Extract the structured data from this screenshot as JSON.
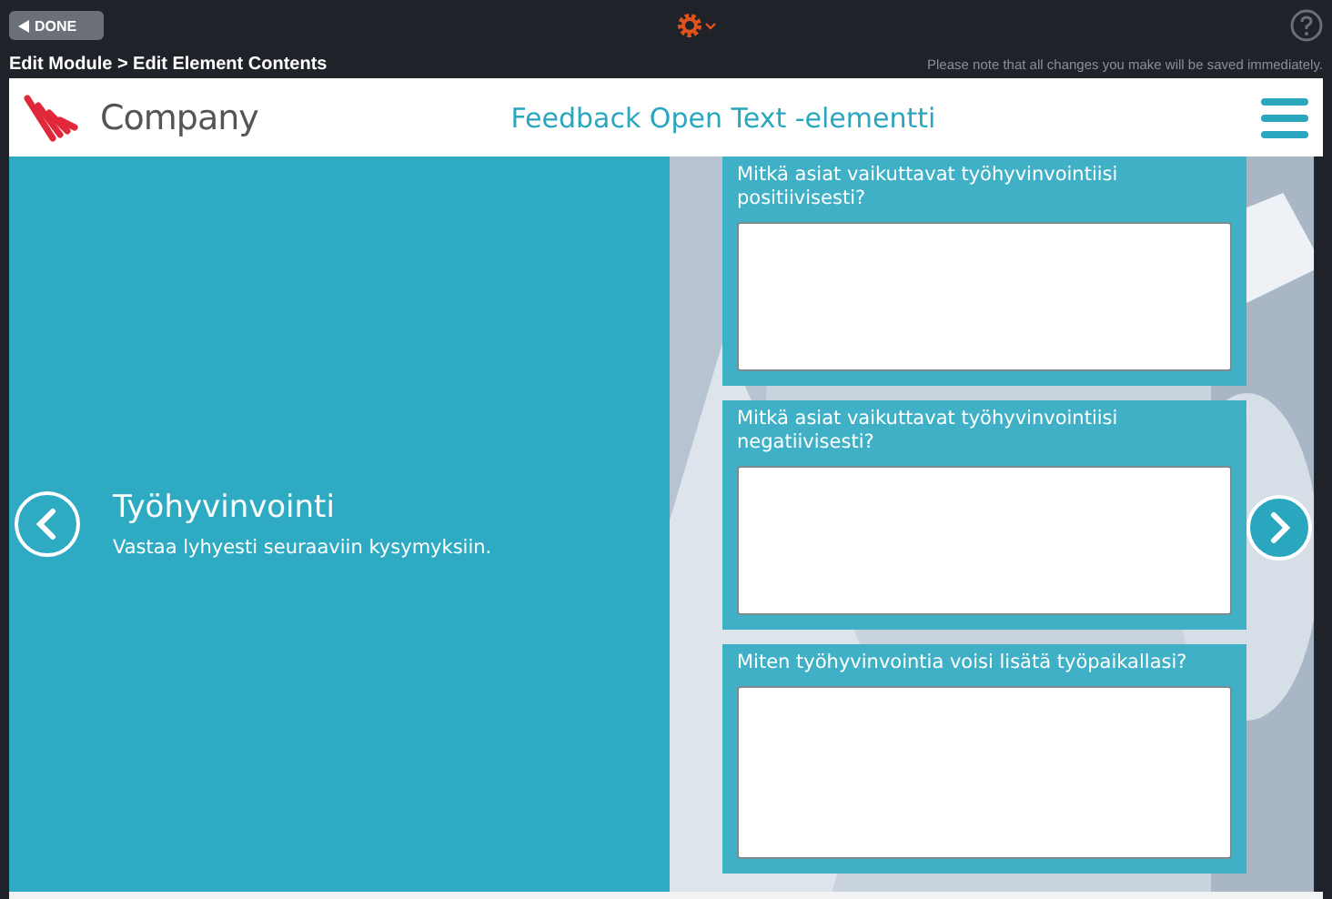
{
  "toolbar": {
    "done_button": "DONE",
    "breadcrumb": "Edit Module > Edit Element Contents",
    "notice": "Please note that all changes you make will be saved immediately."
  },
  "header": {
    "logo_text": "Company",
    "title": "Feedback Open Text -elementti"
  },
  "intro": {
    "title": "Työhyvinvointi",
    "subtitle": "Vastaa lyhyesti seuraaviin kysymyksiin."
  },
  "questions": [
    {
      "label": "Mitkä asiat vaikuttavat työhyvinvointiisi positiivisesti?"
    },
    {
      "label": "Mitkä asiat vaikuttavat työhyvinvointiisi negatiivisesti?"
    },
    {
      "label": "Miten työhyvinvointia voisi lisätä työpaikallasi?"
    }
  ]
}
